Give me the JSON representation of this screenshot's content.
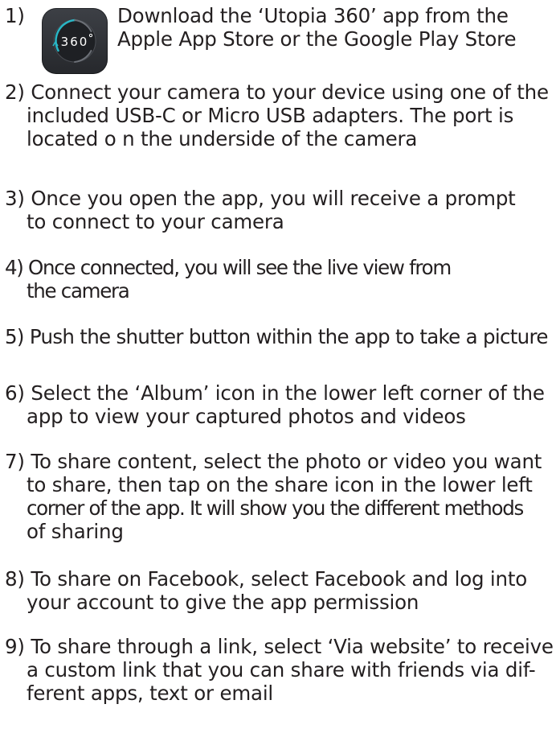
{
  "steps": [
    {
      "number": "1)",
      "lines": [
        "Download the ‘Utopia 360’ app from the",
        "Apple App Store or the Google Play Store"
      ]
    },
    {
      "number": "2)",
      "lines": [
        "Connect your camera to your device using one of the",
        "included USB-C or Micro USB adapters. The port is",
        "located o n the underside of the camera"
      ]
    },
    {
      "number": "3)",
      "lines": [
        "Once you open the app, you will receive a prompt",
        "to connect to your camera"
      ]
    },
    {
      "number": "4)",
      "lines": [
        "Once connected, you will see the live view from",
        "the camera"
      ]
    },
    {
      "number": "5)",
      "lines": [
        "Push the shutter button within the app to take a picture"
      ]
    },
    {
      "number": "6)",
      "lines": [
        "Select the ‘Album’ icon in the lower left corner of the",
        "app to view your captured photos and videos"
      ]
    },
    {
      "number": "7)",
      "lines": [
        "To share content, select the photo or video you want",
        "to share, then tap on the share icon in the lower left",
        "corner of the app. It will show you the different methods",
        "of sharing"
      ]
    },
    {
      "number": "8)",
      "lines": [
        "To share on Facebook, select Facebook and log into",
        "your account to give the app permission"
      ]
    },
    {
      "number": "9)",
      "lines": [
        "To share through a link, select ‘Via website’ to receive",
        "a custom link that you can share with friends via dif-",
        "ferent apps, text or email"
      ]
    }
  ],
  "app_icon": {
    "name": "utopia-360-app-icon",
    "text": "360",
    "ring_color": "#29b6c5"
  }
}
